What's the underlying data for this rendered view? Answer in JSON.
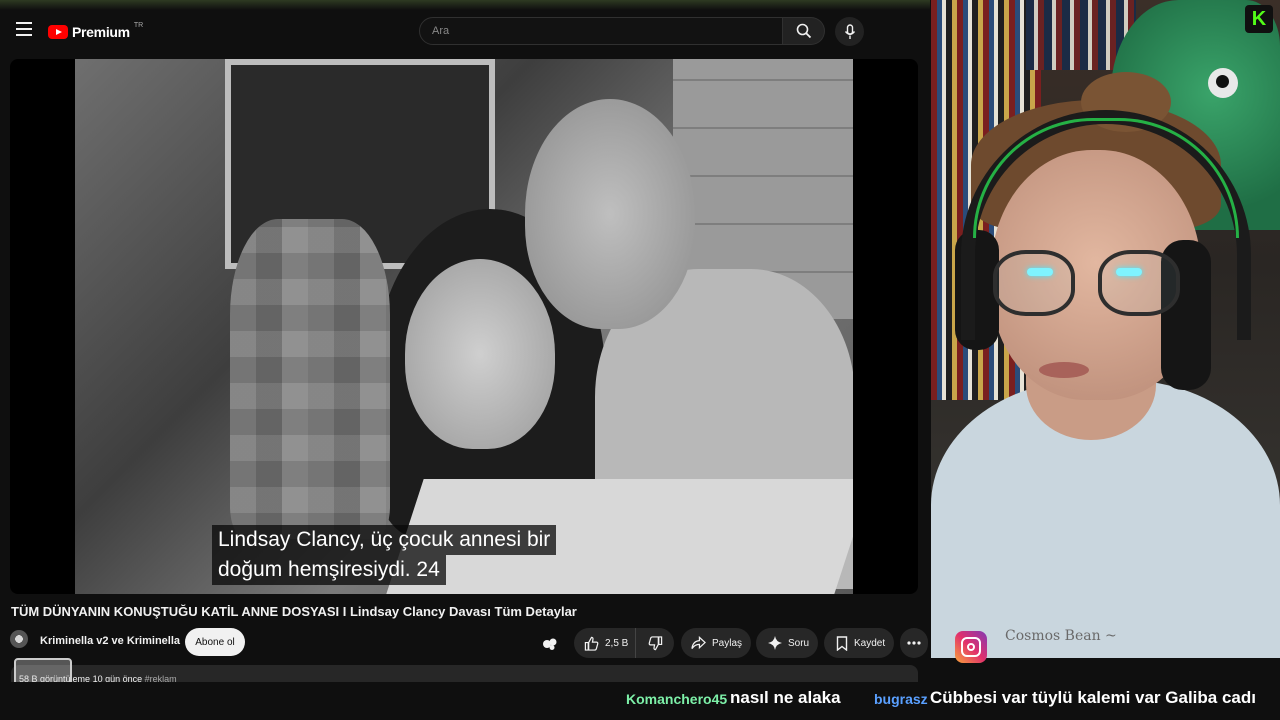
{
  "youtube": {
    "logo_text": "Premium",
    "logo_region": "TR",
    "search": {
      "placeholder": "Ara"
    },
    "video": {
      "subtitle_line1": "Lindsay Clancy, üç çocuk annesi bir",
      "subtitle_line2": "doğum hemşiresiydi. 24"
    },
    "title": "TÜM DÜNYANIN KONUŞTUĞU KATİL ANNE DOSYASI I Lindsay Clancy Davası Tüm Detaylar",
    "channel_name": "Kriminella v2 ve Kriminella",
    "subscribe_label": "Abone ol",
    "like_count": "2,5 B",
    "share_label": "Paylaş",
    "ask_label": "Soru",
    "save_label": "Kaydet",
    "meta": {
      "views": "58 B görüntüleme",
      "age": "10 gün önce",
      "tag": "#reklam"
    }
  },
  "overlay": {
    "kick_letter": "K",
    "cosmos_text": "Cosmos Bean ~"
  },
  "chat": [
    {
      "user": "Komanchero45",
      "message": "nasıl ne alaka",
      "user_color": "#7df0a8"
    },
    {
      "user": "bugrasz",
      "message": "Cübbesi var tüylü kalemi var Galiba cadı",
      "user_color": "#5aa0ff"
    }
  ],
  "colors": {
    "accent": "#ff0000",
    "kick_green": "#53fc18"
  }
}
